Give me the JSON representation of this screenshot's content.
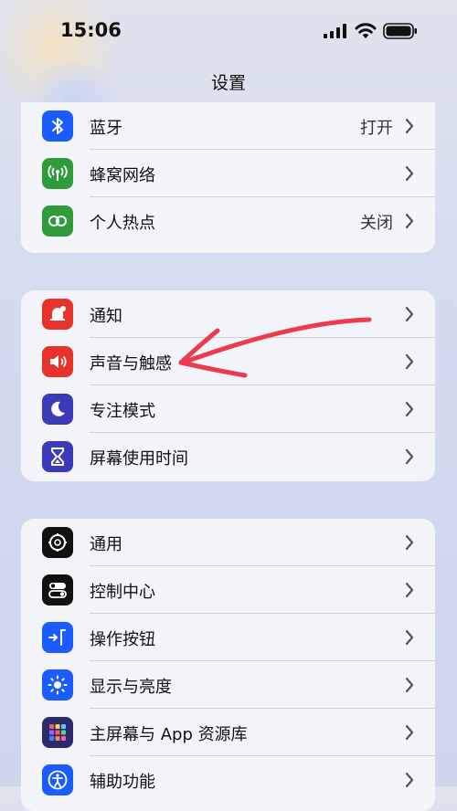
{
  "status": {
    "time": "15:06"
  },
  "nav": {
    "title": "设置"
  },
  "groups": [
    {
      "rows": [
        {
          "label": "蓝牙",
          "value": "打开",
          "icon": "bluetooth-icon",
          "color": "#1a5cff"
        },
        {
          "label": "蜂窝网络",
          "value": "",
          "icon": "cellular-icon",
          "color": "#2e9c3a"
        },
        {
          "label": "个人热点",
          "value": "关闭",
          "icon": "hotspot-icon",
          "color": "#2e9c3a"
        }
      ]
    },
    {
      "rows": [
        {
          "label": "通知",
          "value": "",
          "icon": "notification-icon",
          "color": "#e8332c"
        },
        {
          "label": "声音与触感",
          "value": "",
          "icon": "speaker-icon",
          "color": "#e8332c"
        },
        {
          "label": "专注模式",
          "value": "",
          "icon": "moon-icon",
          "color": "#3b3ab8"
        },
        {
          "label": "屏幕使用时间",
          "value": "",
          "icon": "hourglass-icon",
          "color": "#3b3ab8"
        }
      ]
    },
    {
      "rows": [
        {
          "label": "通用",
          "value": "",
          "icon": "gear-icon",
          "color": "#8a8a8e"
        },
        {
          "label": "控制中心",
          "value": "",
          "icon": "switches-icon",
          "color": "#8a8a8e"
        },
        {
          "label": "操作按钮",
          "value": "",
          "icon": "action-button-icon",
          "color": "#1a5cff"
        },
        {
          "label": "显示与亮度",
          "value": "",
          "icon": "sun-icon",
          "color": "#1a5cff"
        },
        {
          "label": "主屏幕与 App 资源库",
          "value": "",
          "icon": "home-screen-icon",
          "color": "#3b3ab8"
        },
        {
          "label": "辅助功能",
          "value": "",
          "icon": "accessibility-icon",
          "color": "#1a5cff"
        }
      ]
    }
  ],
  "annotation": {
    "color": "#ee3a4d"
  }
}
